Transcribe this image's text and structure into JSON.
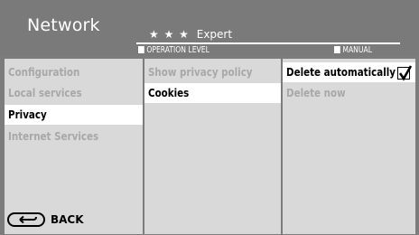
{
  "header": {
    "title": "Network",
    "level_stars": "★ ★ ★",
    "level_name": "Expert",
    "operation_level_label": "OPERATION LEVEL",
    "manual_label": "MANUAL"
  },
  "columns": {
    "left": [
      {
        "label": "Configuration",
        "state": "dim"
      },
      {
        "label": "Local services",
        "state": "dim"
      },
      {
        "label": "Privacy",
        "state": "active"
      },
      {
        "label": "Internet Services",
        "state": "dim"
      }
    ],
    "middle": [
      {
        "label": "Show privacy policy",
        "state": "dim"
      },
      {
        "label": "Cookies",
        "state": "active"
      }
    ],
    "right": [
      {
        "label": "Delete automatically",
        "state": "active",
        "checked": true
      },
      {
        "label": "Delete now",
        "state": "dim"
      }
    ]
  },
  "footer": {
    "back_label": "BACK"
  }
}
